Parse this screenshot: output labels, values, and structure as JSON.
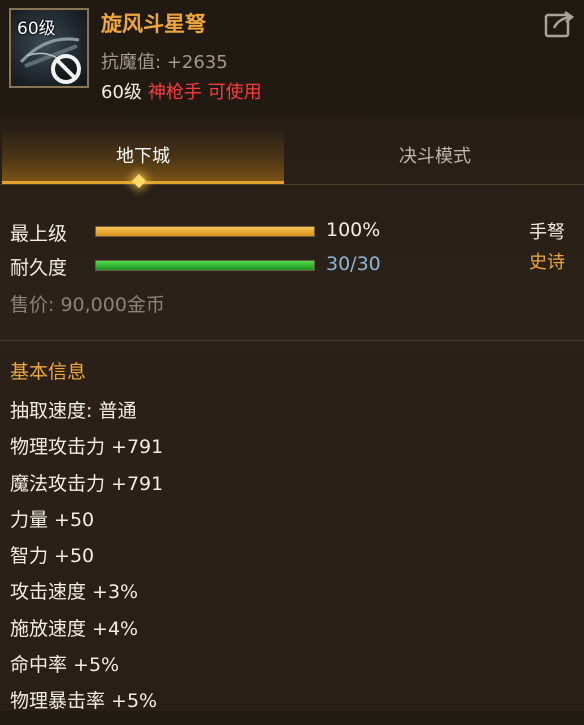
{
  "item": {
    "level_badge": "60级",
    "name": "旋风斗星弩",
    "stat": "抗魔值: +2635",
    "req_level": "60级",
    "req_class": "神枪手 可使用"
  },
  "tabs": [
    {
      "label": "地下城",
      "active": true
    },
    {
      "label": "决斗模式",
      "active": false
    }
  ],
  "bars": [
    {
      "label": "最上级",
      "value_text": "100%",
      "fill_fraction": 1.0,
      "color": "#e8a42a"
    },
    {
      "label": "耐久度",
      "value_text": "30/30",
      "fill_fraction": 1.0,
      "color": "#34c234"
    }
  ],
  "item_type": {
    "weapon": "手弩",
    "rarity": "史诗"
  },
  "price": "售价: 90,000金币",
  "basic_info": {
    "title": "基本信息",
    "lines": [
      "抽取速度: 普通",
      "物理攻击力 +791",
      "魔法攻击力 +791",
      "力量 +50",
      "智力 +50",
      "攻击速度 +3%",
      "施放速度 +4%",
      "命中率 +5%",
      "物理暴击率 +5%"
    ]
  },
  "colors": {
    "accent_gold": "#f0a73a",
    "restriction_red": "#ff3a3a",
    "durability_blue": "#8fb4d6"
  },
  "icons": [
    "crossbow-item-icon",
    "forbidden-icon",
    "share-icon",
    "tab-diamond-icon"
  ]
}
